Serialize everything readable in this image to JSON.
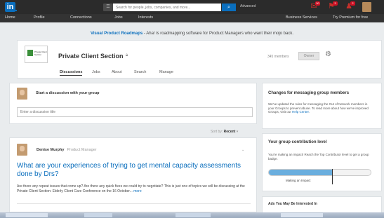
{
  "topbar": {
    "logo_text": "in",
    "search_placeholder": "Search for people, jobs, companies, and more...",
    "search_button_icon": "search-icon",
    "advanced_label": "Advanced",
    "icons": [
      "messages-icon",
      "notifications-icon",
      "add-connections-icon",
      "profile-avatar"
    ],
    "badges": [
      "30",
      "3",
      "2"
    ]
  },
  "nav": {
    "items": [
      "Home",
      "Profile",
      "Connections",
      "Jobs",
      "Interests"
    ],
    "business_services": "Business Services",
    "try_premium": "Try Premium for free"
  },
  "banner": {
    "ad_title": "Visual Product Roadmaps",
    "ad_text": " - Aha! is roadmapping software for Product Managers who want their mojo back."
  },
  "group": {
    "logo_text": "Private Client Section",
    "title": "Private Client Section",
    "lock_icon": "lock-icon",
    "members": "345 members",
    "owner_label": "Owner",
    "gear_icon": "gear-icon",
    "tabs": [
      "Discussions",
      "Jobs",
      "About",
      "Search",
      "Manage"
    ]
  },
  "start_discussion": {
    "label": "Start a discussion with your group",
    "input_placeholder": "Enter a discussion title"
  },
  "sort": {
    "label": "Sort by:",
    "value": "Recent",
    "caret": "▾"
  },
  "post": {
    "author": "Denise Murphy",
    "role": "Product Manager",
    "title": "What are your experiences of trying to get mental capacity assessments done by Drs?",
    "body": "Are there any repeat issues that come up? Are there any quick fixes we could try to negotiate? This is just one of topics we will be discussing at the Private Client Section: Elderly Client Care Conference on the 16 October...",
    "more_label": "more"
  },
  "right_column": {
    "messaging": {
      "title": "Changes for messaging group members",
      "text": "We've updated the rules for messaging the Out of Network members in your Groups to prevent abuse. To read more about how we've improved Groups, visit our ",
      "link": "Help Center",
      "text_end": "."
    },
    "contribution": {
      "title": "Your group contribution level",
      "text": "You're making an impact! Reach the Top Contributor level to get a group badge.",
      "level_label": "Making an Impact",
      "progress": 0.62
    },
    "ads": {
      "title": "Ads You May Be Interested In"
    }
  },
  "colors": {
    "brand": "#0a6ebd",
    "topbar": "#2b2b2b",
    "badge": "#d11124"
  }
}
